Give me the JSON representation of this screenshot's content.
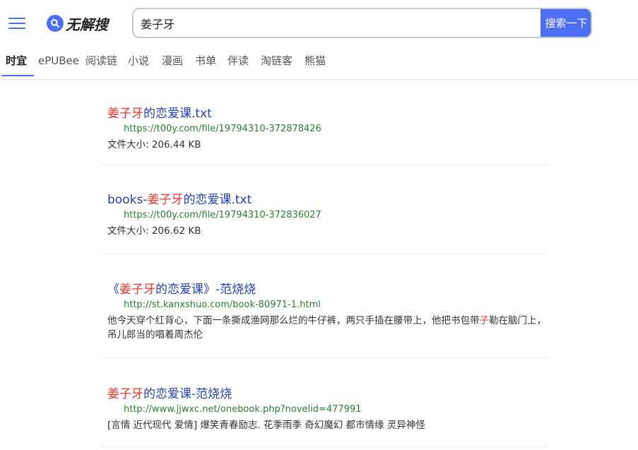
{
  "header": {
    "logo_text": "无解搜",
    "search": {
      "value": "姜子牙",
      "placeholder": ""
    },
    "search_button_label": "搜索一下"
  },
  "tabs": [
    {
      "label": "时宜",
      "active": true
    },
    {
      "label": "ePUBee",
      "active": false
    },
    {
      "label": "阅读链",
      "active": false
    },
    {
      "label": "小说",
      "active": false
    },
    {
      "label": "漫画",
      "active": false
    },
    {
      "label": "书单",
      "active": false
    },
    {
      "label": "伴读",
      "active": false
    },
    {
      "label": "淘链客",
      "active": false
    },
    {
      "label": "熊猫",
      "active": false
    }
  ],
  "results": [
    {
      "title_before": "",
      "title_highlight": "姜子牙",
      "title_after": "的恋爱课.txt",
      "url": "https://t00y.com/file/19794310-372878426",
      "desc": "文件大小: 206.44 KB"
    },
    {
      "title_before": "books-",
      "title_highlight": "姜子牙",
      "title_after": "的恋爱课.txt",
      "url": "https://t00y.com/file/19794310-372836027",
      "desc": "文件大小: 206.62 KB"
    },
    {
      "title_before": "《",
      "title_highlight": "姜子牙",
      "title_after": "的恋爱课》-范烧烧",
      "url": "http://st.kanxshuo.com/book-80971-1.html",
      "desc_before": "他今天穿个红背心，下面一条撕成渔网那么烂的牛仔裤，两只手插在腰带上，他把书包带",
      "desc_highlight": "子",
      "desc_after": "勒在脑门上，吊儿郎当的唱着周杰伦"
    },
    {
      "title_before": "",
      "title_highlight": "姜子牙",
      "title_after": "的恋爱课-范烧烧",
      "url": "http://www.jjwxc.net/onebook.php?novelid=477991",
      "desc": "[言情 近代现代 爱情] 爆笑青春励志. 花季雨季 奇幻魔幻 都市情缘 灵异神怪"
    }
  ],
  "colors": {
    "accent": "#4e6ef2",
    "link": "#2440b3",
    "highlight": "#e5362c",
    "url": "#2e7d32"
  },
  "icons": {
    "menu": "hamburger-menu-icon",
    "logo": "search-magnifier-icon"
  }
}
